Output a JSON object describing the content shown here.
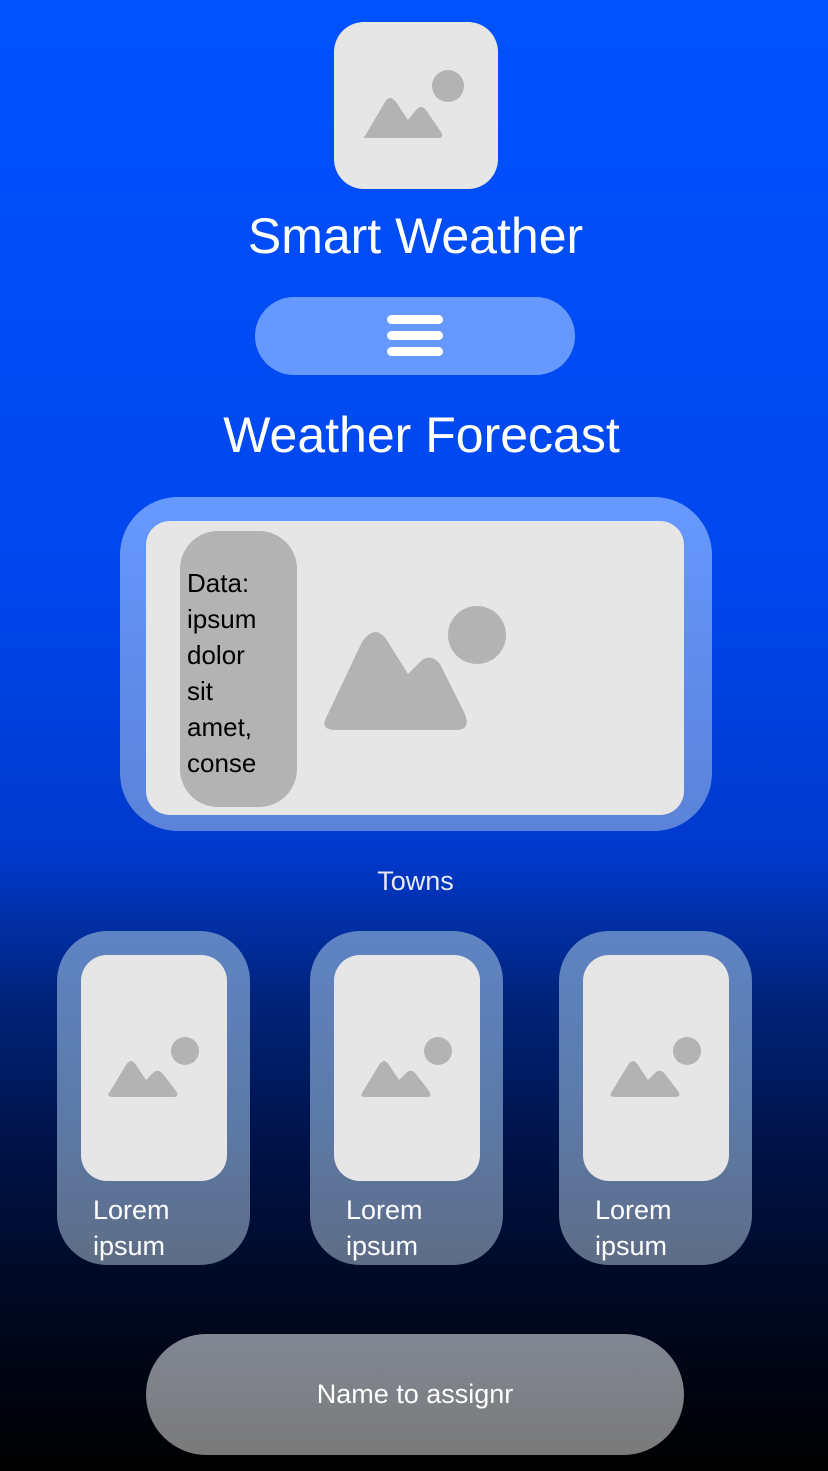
{
  "app": {
    "title": "Smart Weather",
    "logo_icon": "image-placeholder-icon"
  },
  "header": {
    "menu_icon": "hamburger-menu-icon"
  },
  "forecast": {
    "title": "Weather Forecast",
    "data_text": "Data: ipsum dolor sit amet, conse",
    "image_icon": "image-placeholder-icon"
  },
  "towns": {
    "label": "Towns",
    "items": [
      {
        "label": "Lorem ipsum"
      },
      {
        "label": "Lorem ipsum"
      },
      {
        "label": "Lorem ipsum"
      }
    ]
  },
  "footer": {
    "assign_button_label": "Name to assignr"
  },
  "colors": {
    "background_top": "#0052ff",
    "background_bottom": "#000000",
    "menu_button": "#6699ff",
    "card_inner": "#e6e6e6",
    "placeholder_glyph": "#b3b3b3",
    "assign_button": "#7a7a7a"
  }
}
